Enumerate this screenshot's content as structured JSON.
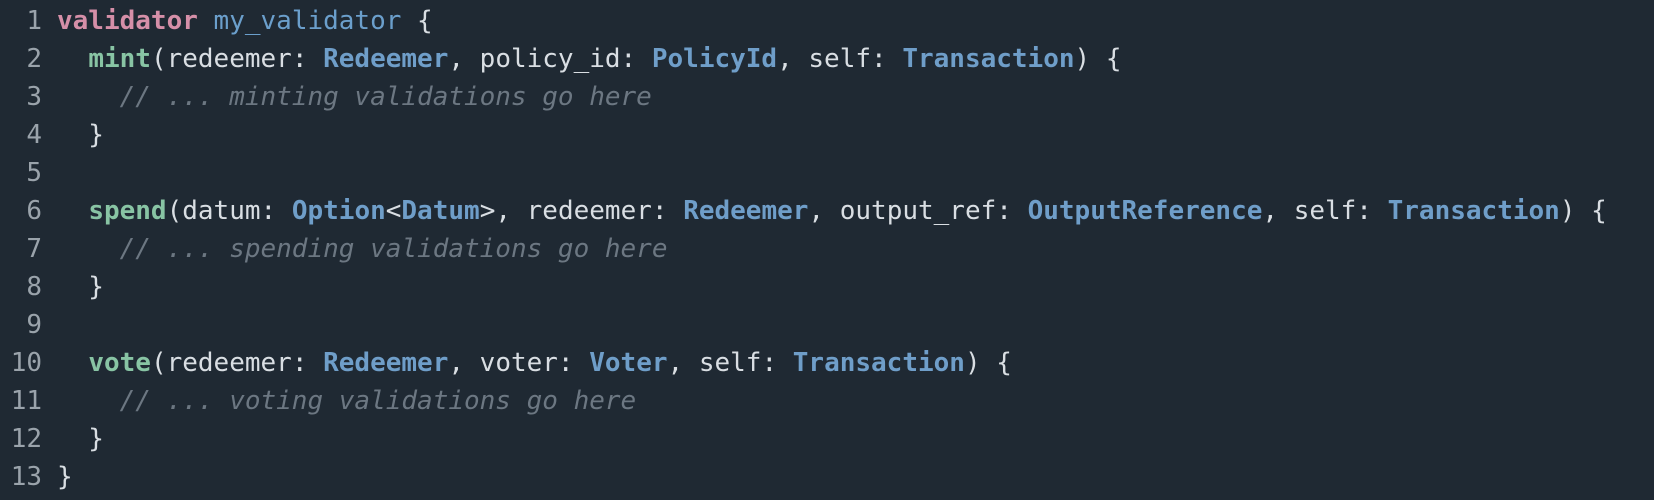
{
  "colors": {
    "background": "#1f2933",
    "keyword": "#d58fa8",
    "validator_name": "#6b9fcc",
    "function": "#88c4a4",
    "type": "#6f9ec9",
    "text": "#d9dee3",
    "comment": "#6c7782",
    "line_number": "#9aa3ab"
  },
  "lines": [
    {
      "number": "1",
      "tokens": [
        {
          "t": "validator",
          "k": "kw"
        },
        {
          "t": " ",
          "k": "plain"
        },
        {
          "t": "my_validator",
          "k": "name"
        },
        {
          "t": " {",
          "k": "plain"
        }
      ]
    },
    {
      "number": "2",
      "tokens": [
        {
          "t": "  ",
          "k": "plain"
        },
        {
          "t": "mint",
          "k": "fn"
        },
        {
          "t": "(redeemer: ",
          "k": "plain"
        },
        {
          "t": "Redeemer",
          "k": "type"
        },
        {
          "t": ", policy_id: ",
          "k": "plain"
        },
        {
          "t": "PolicyId",
          "k": "type"
        },
        {
          "t": ", self: ",
          "k": "plain"
        },
        {
          "t": "Transaction",
          "k": "type"
        },
        {
          "t": ") {",
          "k": "plain"
        }
      ]
    },
    {
      "number": "3",
      "tokens": [
        {
          "t": "    ",
          "k": "plain"
        },
        {
          "t": "// ... minting validations go here",
          "k": "comment"
        }
      ]
    },
    {
      "number": "4",
      "tokens": [
        {
          "t": "  }",
          "k": "plain"
        }
      ]
    },
    {
      "number": "5",
      "tokens": []
    },
    {
      "number": "6",
      "tokens": [
        {
          "t": "  ",
          "k": "plain"
        },
        {
          "t": "spend",
          "k": "fn"
        },
        {
          "t": "(datum: ",
          "k": "plain"
        },
        {
          "t": "Option",
          "k": "type"
        },
        {
          "t": "<",
          "k": "plain"
        },
        {
          "t": "Datum",
          "k": "type"
        },
        {
          "t": ">, redeemer: ",
          "k": "plain"
        },
        {
          "t": "Redeemer",
          "k": "type"
        },
        {
          "t": ", output_ref: ",
          "k": "plain"
        },
        {
          "t": "OutputReference",
          "k": "type"
        },
        {
          "t": ", self: ",
          "k": "plain"
        },
        {
          "t": "Transaction",
          "k": "type"
        },
        {
          "t": ") {",
          "k": "plain"
        }
      ]
    },
    {
      "number": "7",
      "tokens": [
        {
          "t": "    ",
          "k": "plain"
        },
        {
          "t": "// ... spending validations go here",
          "k": "comment"
        }
      ]
    },
    {
      "number": "8",
      "tokens": [
        {
          "t": "  }",
          "k": "plain"
        }
      ]
    },
    {
      "number": "9",
      "tokens": []
    },
    {
      "number": "10",
      "tokens": [
        {
          "t": "  ",
          "k": "plain"
        },
        {
          "t": "vote",
          "k": "fn"
        },
        {
          "t": "(redeemer: ",
          "k": "plain"
        },
        {
          "t": "Redeemer",
          "k": "type"
        },
        {
          "t": ", voter: ",
          "k": "plain"
        },
        {
          "t": "Voter",
          "k": "type"
        },
        {
          "t": ", self: ",
          "k": "plain"
        },
        {
          "t": "Transaction",
          "k": "type"
        },
        {
          "t": ") {",
          "k": "plain"
        }
      ]
    },
    {
      "number": "11",
      "tokens": [
        {
          "t": "    ",
          "k": "plain"
        },
        {
          "t": "// ... voting validations go here",
          "k": "comment"
        }
      ]
    },
    {
      "number": "12",
      "tokens": [
        {
          "t": "  }",
          "k": "plain"
        }
      ]
    },
    {
      "number": "13",
      "tokens": [
        {
          "t": "}",
          "k": "plain"
        }
      ]
    }
  ]
}
